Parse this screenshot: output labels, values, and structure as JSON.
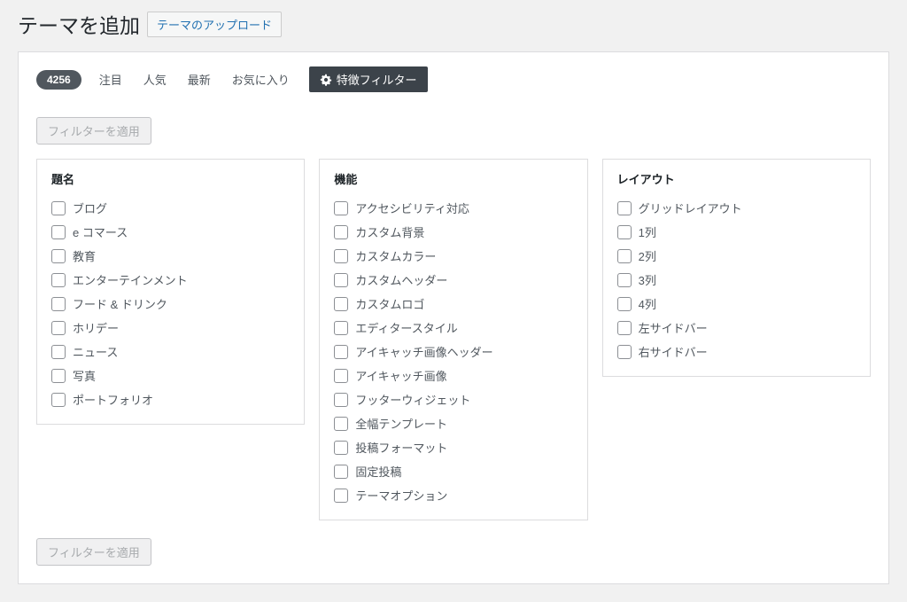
{
  "header": {
    "title": "テーマを追加",
    "upload_label": "テーマのアップロード"
  },
  "filterbar": {
    "count": "4256",
    "tabs": {
      "featured": "注目",
      "popular": "人気",
      "latest": "最新",
      "favorites": "お気に入り"
    },
    "feature_filter": "特徴フィルター"
  },
  "apply_label": "フィルターを適用",
  "columns": {
    "subject": {
      "heading": "題名",
      "items": [
        "ブログ",
        "e コマース",
        "教育",
        "エンターテインメント",
        "フード & ドリンク",
        "ホリデー",
        "ニュース",
        "写真",
        "ポートフォリオ"
      ]
    },
    "features": {
      "heading": "機能",
      "items": [
        "アクセシビリティ対応",
        "カスタム背景",
        "カスタムカラー",
        "カスタムヘッダー",
        "カスタムロゴ",
        "エディタースタイル",
        "アイキャッチ画像ヘッダー",
        "アイキャッチ画像",
        "フッターウィジェット",
        "全幅テンプレート",
        "投稿フォーマット",
        "固定投稿",
        "テーマオプション"
      ]
    },
    "layout": {
      "heading": "レイアウト",
      "items": [
        "グリッドレイアウト",
        "1列",
        "2列",
        "3列",
        "4列",
        "左サイドバー",
        "右サイドバー"
      ]
    }
  }
}
